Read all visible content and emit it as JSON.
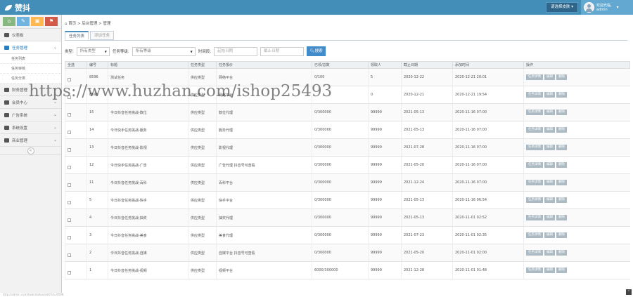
{
  "brand": "赞抖",
  "header": {
    "theme_label": "请选择皮肤",
    "welcome": "欢迎光临,",
    "username": "admin"
  },
  "sidebar": {
    "shortcuts": [
      "⌂",
      "✎",
      "▣",
      "⚑"
    ],
    "items": [
      {
        "label": "仪表板",
        "open": false,
        "arrow": ""
      },
      {
        "label": "任务管理",
        "open": true,
        "arrow": "⌄"
      },
      {
        "label": "财务管理",
        "open": false,
        "arrow": ""
      },
      {
        "label": "会员中心",
        "open": false,
        "arrow": "⌄"
      },
      {
        "label": "广告系统",
        "open": false,
        "arrow": "⌄"
      },
      {
        "label": "系统设置",
        "open": false,
        "arrow": "⌄"
      },
      {
        "label": "商业管理",
        "open": false,
        "arrow": "⌄"
      }
    ],
    "subitems": [
      "任务列表",
      "任务审核",
      "任务分类"
    ],
    "collapse_icon": "«"
  },
  "breadcrumb": "首页 > 后台管理 > 管理",
  "tabs": [
    "任务列表",
    "添加任务"
  ],
  "filters": {
    "type_label": "类型:",
    "type_value": "所有类型",
    "level_label": "任务等级:",
    "level_value": "所有等级",
    "time_label": "时间段:",
    "start_placeholder": "起始日期",
    "end_placeholder": "截止日期",
    "search_label": "搜索"
  },
  "table": {
    "headers": [
      "全选",
      "编号",
      "标题",
      "任务类型",
      "任务报价",
      "已领/总数",
      "领取人",
      "截止日期",
      "添加时间",
      "操作"
    ],
    "rows": [
      [
        "8596",
        "测试任务",
        "供应类型",
        "网络平台",
        "0/100",
        "5",
        "2020-12-22",
        "2020-12-21 20:01"
      ],
      [
        "8595",
        "",
        "供应类型",
        "网络平台",
        "",
        "0",
        "2020-12-21",
        "2020-12-21 19:54"
      ],
      [
        "15",
        "今日抖音任务挑战-数位",
        "供应类型",
        "数位代理",
        "0/300000",
        "99999",
        "2021-05-13",
        "2020-11-16 07:00"
      ],
      [
        "14",
        "今日快手任务挑战-服务",
        "供应类型",
        "服务代理",
        "0/300000",
        "99999",
        "2021-05-13",
        "2020-11-16 07:00"
      ],
      [
        "13",
        "今日抖音任务挑战-影视",
        "供应类型",
        "影视代理",
        "0/300000",
        "99999",
        "2021-07-28",
        "2020-11-16 07:00"
      ],
      [
        "12",
        "今日快手任务挑战-广告",
        "供应类型",
        "广告代理 抖音号可查看",
        "0/300000",
        "99999",
        "2021-05-20",
        "2020-11-16 07:00"
      ],
      [
        "11",
        "今日抖音任务挑战-百科",
        "供应类型",
        "百科平台",
        "0/300000",
        "99999",
        "2021-12-24",
        "2020-11-16 07:00"
      ],
      [
        "5",
        "今日抖音任务挑战-快手",
        "供应类型",
        "快手平台",
        "0/300000",
        "99999",
        "2021-05-13",
        "2020-11-16 06:54"
      ],
      [
        "4",
        "今日抖音任务挑战-抽奖",
        "供应类型",
        "抽奖代理",
        "0/300000",
        "99999",
        "2021-05-13",
        "2020-11-01 02:52"
      ],
      [
        "3",
        "今日抖音任务挑战-美食",
        "供应类型",
        "美食代理",
        "0/300000",
        "99999",
        "2021-07-23",
        "2020-11-01 02:35"
      ],
      [
        "2",
        "今日抖音任务挑战-自媒",
        "供应类型",
        "自媒平台 抖音号可查看",
        "0/300000",
        "99999",
        "2021-05-20",
        "2020-11-01 02:00"
      ],
      [
        "1",
        "今日抖音任务挑战-视频",
        "供应类型",
        "视频平台",
        "6000/300000",
        "99999",
        "2021-12-28",
        "2020-11-01 01:48"
      ]
    ],
    "actions": [
      "任务详情",
      "编辑",
      "删除"
    ]
  },
  "watermark": "https://www.huzhan.com/ishop25493",
  "statusbar": "http://admin.com/task/status/edit?id=9596",
  "colors": {
    "topbar": "#438eb9",
    "accent": "#428bca"
  }
}
